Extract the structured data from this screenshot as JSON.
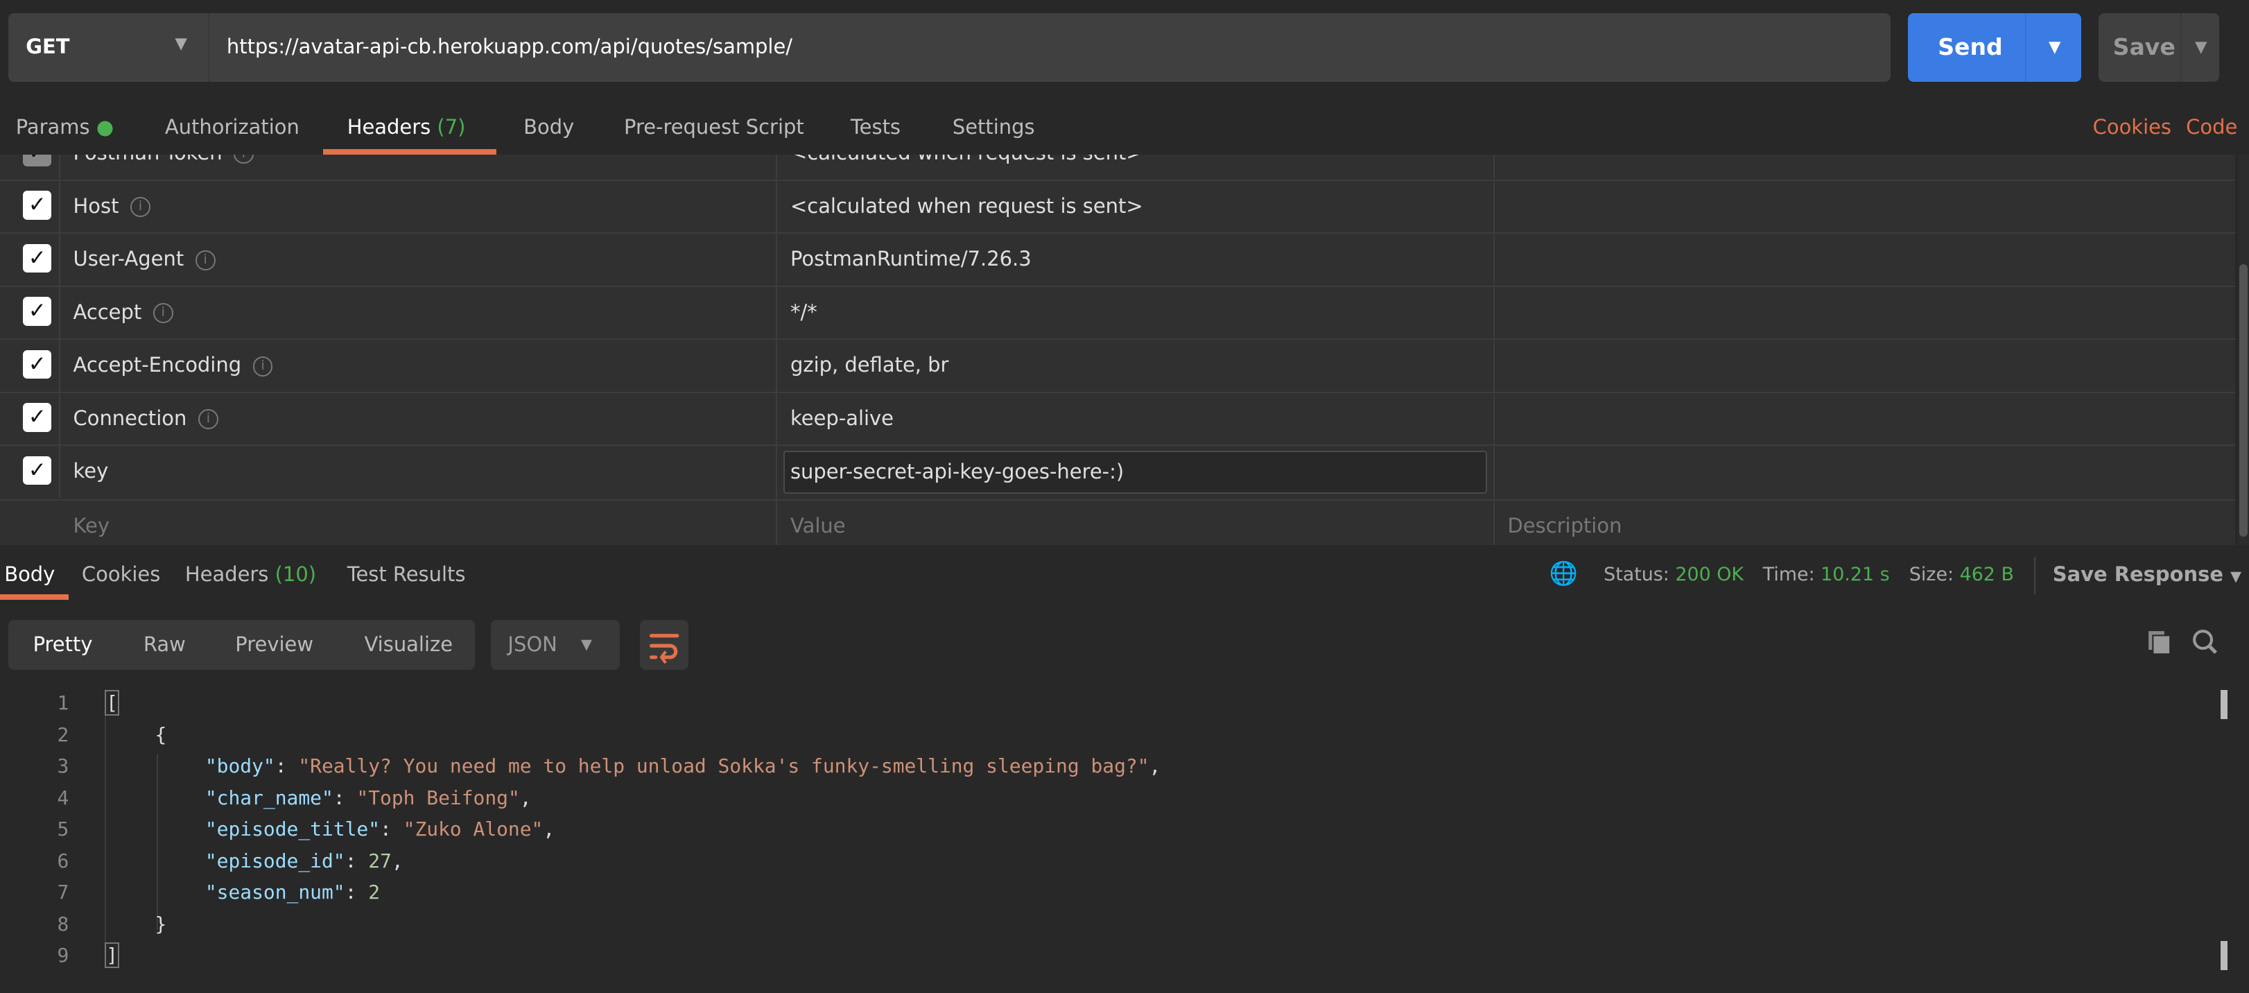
{
  "request": {
    "method": "GET",
    "url": "https://avatar-api-cb.herokuapp.com/api/quotes/sample/",
    "send_label": "Send",
    "save_label": "Save"
  },
  "request_tabs": [
    {
      "label": "Params"
    },
    {
      "label": "Authorization"
    },
    {
      "label": "Headers",
      "count": "(7)",
      "active": true
    },
    {
      "label": "Body"
    },
    {
      "label": "Pre-request Script"
    },
    {
      "label": "Tests"
    },
    {
      "label": "Settings"
    }
  ],
  "request_links": {
    "cookies": "Cookies",
    "code": "Code"
  },
  "headers_table": {
    "partial_row": {
      "key": "Postman-Token",
      "value": "<calculated when request is sent>"
    },
    "rows": [
      {
        "key": "Host",
        "value": "<calculated when request is sent>",
        "checked": true
      },
      {
        "key": "User-Agent",
        "value": "PostmanRuntime/7.26.3",
        "checked": true
      },
      {
        "key": "Accept",
        "value": "*/*",
        "checked": true
      },
      {
        "key": "Accept-Encoding",
        "value": "gzip, deflate, br",
        "checked": true
      },
      {
        "key": "Connection",
        "value": "keep-alive",
        "checked": true
      },
      {
        "key": "key",
        "value": "super-secret-api-key-goes-here-:)",
        "checked": true
      }
    ],
    "placeholders": {
      "key": "Key",
      "value": "Value",
      "description": "Description"
    }
  },
  "response_tabs": [
    {
      "label": "Body",
      "active": true
    },
    {
      "label": "Cookies"
    },
    {
      "label": "Headers",
      "count": "(10)"
    },
    {
      "label": "Test Results"
    }
  ],
  "response_meta": {
    "status_label": "Status:",
    "status": "200 OK",
    "time_label": "Time:",
    "time": "10.21 s",
    "size_label": "Size:",
    "size": "462 B",
    "save_response": "Save Response"
  },
  "view_modes": [
    "Pretty",
    "Raw",
    "Preview",
    "Visualize"
  ],
  "format": "JSON",
  "code_lines": [
    "1",
    "2",
    "3",
    "4",
    "5",
    "6",
    "7",
    "8",
    "9"
  ],
  "json_body": {
    "k_body": "\"body\"",
    "v_body": "\"Really? You need me to help unload Sokka's funky-smelling sleeping bag?\"",
    "k_char": "\"char_name\"",
    "v_char": "\"Toph Beifong\"",
    "k_title": "\"episode_title\"",
    "v_title": "\"Zuko Alone\"",
    "k_id": "\"episode_id\"",
    "v_id": "27",
    "k_season": "\"season_num\"",
    "v_season": "2"
  },
  "colors": {
    "accent": "#e3714a",
    "send": "#3a7ce4",
    "success": "#4caf50",
    "json_key": "#9cdcfe",
    "json_string": "#ce9178",
    "json_number": "#b5cea8"
  }
}
